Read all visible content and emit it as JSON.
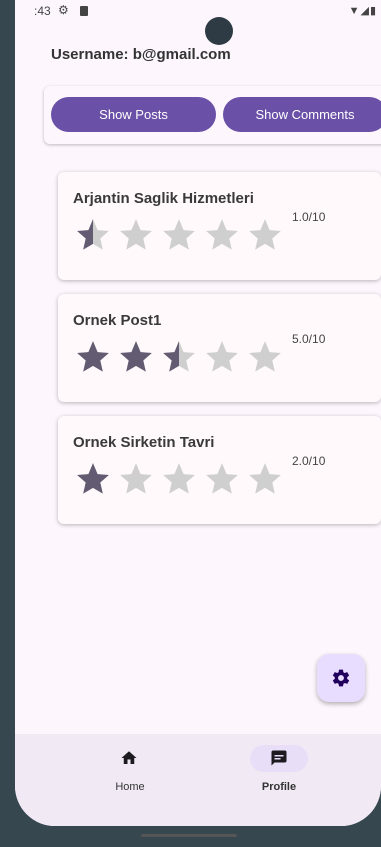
{
  "status_bar": {
    "time": ":43",
    "icons": [
      "gear-icon",
      "sd-card-icon",
      "wifi-icon",
      "signal-icon",
      "battery-icon"
    ]
  },
  "header": {
    "username": "Username: b@gmail.com"
  },
  "buttons": {
    "show_posts": "Show Posts",
    "show_comments": "Show Comments"
  },
  "ratings": [
    {
      "title": "Arjantin Saglik Hizmetleri",
      "score_text": "1.0/10",
      "stars": 0.5
    },
    {
      "title": "Ornek Post1",
      "score_text": "5.0/10",
      "stars": 2.5
    },
    {
      "title": "Ornek Sirketin Tavri",
      "score_text": "2.0/10",
      "stars": 1
    }
  ],
  "stars_max": 5,
  "fab": {
    "icon": "gear-icon"
  },
  "bottom_nav": {
    "items": [
      {
        "label": "Home",
        "icon": "home-icon",
        "selected": false
      },
      {
        "label": "Profile",
        "icon": "profile-chat-icon",
        "selected": true
      }
    ]
  },
  "colors": {
    "primary_button": "#6a50a7",
    "star_filled": "#625b71",
    "star_empty": "#cfcfcf",
    "fab_background": "#e9ddff",
    "nav_background": "#f1eaf5",
    "nav_selected_pill": "#e8def8"
  }
}
